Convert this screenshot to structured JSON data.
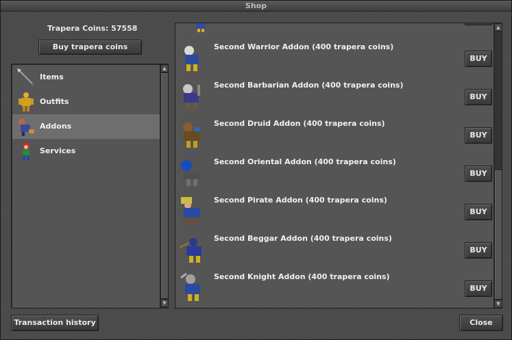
{
  "window": {
    "title": "Shop"
  },
  "header": {
    "coins_text": "Trapera Coins: 57558",
    "buy_coins_label": "Buy trapera coins"
  },
  "categories": [
    {
      "label": "Items",
      "icon": "spear-icon",
      "selected": false
    },
    {
      "label": "Outfits",
      "icon": "golden-armor-icon",
      "selected": false
    },
    {
      "label": "Addons",
      "icon": "addon-outfit-icon",
      "selected": true
    },
    {
      "label": "Services",
      "icon": "character-icon",
      "selected": false
    }
  ],
  "offers": [
    {
      "name": "Second Warrior Addon (400 trapera coins)",
      "icon": "warrior-outfit-icon",
      "buy_label": "BUY"
    },
    {
      "name": "Second Barbarian Addon (400 trapera coins)",
      "icon": "barbarian-outfit-icon",
      "buy_label": "BUY"
    },
    {
      "name": "Second Druid Addon (400 trapera coins)",
      "icon": "druid-outfit-icon",
      "buy_label": "BUY"
    },
    {
      "name": "Second Oriental Addon (400 trapera coins)",
      "icon": "oriental-outfit-icon",
      "buy_label": "BUY"
    },
    {
      "name": "Second Pirate Addon (400 trapera coins)",
      "icon": "pirate-outfit-icon",
      "buy_label": "BUY"
    },
    {
      "name": "Second Beggar Addon (400 trapera coins)",
      "icon": "beggar-outfit-icon",
      "buy_label": "BUY"
    },
    {
      "name": "Second Knight Addon (400 trapera coins)",
      "icon": "knight-outfit-icon",
      "buy_label": "BUY"
    }
  ],
  "footer": {
    "history_label": "Transaction history",
    "close_label": "Close"
  },
  "colors": {
    "panel_bg": "#555555",
    "window_bg": "#4a4a4a",
    "selected_bg": "#6e6e6e",
    "text": "#f0f0f0"
  }
}
